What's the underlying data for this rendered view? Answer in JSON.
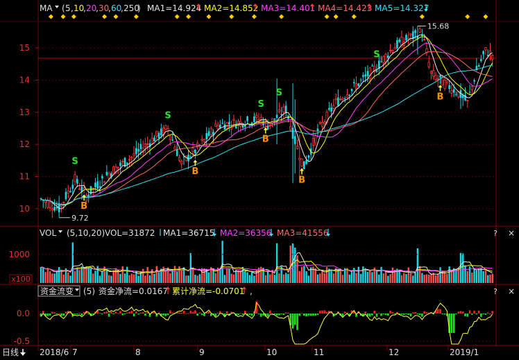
{
  "ma_header": {
    "label": "MA",
    "params_open": "(",
    "p1": "5",
    "p2": "10",
    "p3": "20",
    "p4": "30",
    "p5": "60",
    "p6": "250",
    "params_close": ")",
    "ma1": "MA1=14.924",
    "ma2": "MA2=14.852",
    "ma3": "MA3=14.401",
    "ma4": "MA4=14.423",
    "ma5": "MA5=14.327"
  },
  "vol_header": {
    "label": "VOL",
    "params": "(5,10,20)",
    "vol": "VOL=31872",
    "ma1": "MA1=36715",
    "ma2": "MA2=36356",
    "ma3": "MA3=41556"
  },
  "fund_header": {
    "dropdown": "资金流变",
    "param": "(5)",
    "net": "资金净流=0.0167",
    "cum": "累计净流=-0.0701",
    "tail": ","
  },
  "panel_controls": {
    "q": "?",
    "x": "×"
  },
  "time_axis": {
    "period_button": "日线",
    "labels": [
      "2018/6",
      "7",
      "8",
      "9",
      "10",
      "11",
      "12",
      "2019/1"
    ]
  },
  "price_axis": {
    "ticks": [
      "15",
      "14",
      "13",
      "12",
      "11",
      "10"
    ]
  },
  "vol_axis": {
    "ticks": [
      "1000",
      "x100"
    ]
  },
  "fund_axis": {
    "ticks": [
      "0.0",
      "-0.5"
    ]
  },
  "chart_data": [
    {
      "type": "candlestick",
      "name": "price",
      "ylim": [
        9.5,
        15.8
      ],
      "high_annotation": "15.68",
      "low_annotation": "9.72",
      "signals": [
        {
          "label": "S",
          "idx": 15
        },
        {
          "label": "B",
          "idx": 19
        },
        {
          "label": "S",
          "idx": 56
        },
        {
          "label": "B",
          "idx": 68
        },
        {
          "label": "S",
          "idx": 97
        },
        {
          "label": "B",
          "idx": 99
        },
        {
          "label": "S",
          "idx": 105
        },
        {
          "label": "B",
          "idx": 115
        },
        {
          "label": "S",
          "idx": 148
        },
        {
          "label": "B",
          "idx": 176
        }
      ],
      "colors": {
        "up": "#ff3b3b",
        "down": "#19d8e6",
        "ma1": "#e8e8e8",
        "ma2": "#ffff00",
        "ma3": "#ff40ff",
        "ma4": "#ff6a6a",
        "ma5": "#30e0f0"
      }
    },
    {
      "type": "bar",
      "name": "volume",
      "ylim": [
        0,
        1600
      ]
    },
    {
      "type": "bar",
      "name": "fund_flow",
      "ylim": [
        -0.55,
        0.3
      ]
    }
  ]
}
